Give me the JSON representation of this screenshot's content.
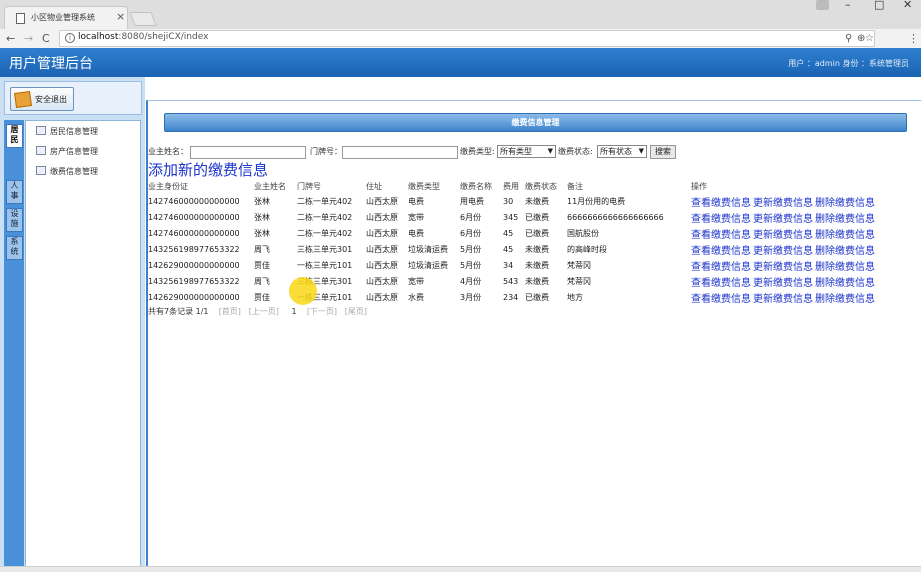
{
  "browser": {
    "tab_title": "小区物业管理系统",
    "tab_close": "×",
    "url_host": "localhost",
    "url_path": ":8080/shejiCX/index",
    "win_min": "–",
    "win_max": "□",
    "win_close": "✕",
    "back": "←",
    "forward": "→",
    "reload": "C",
    "menu": "⋮",
    "zoom_icon": "⊕",
    "pin_icon": "⚲",
    "star_icon": "☆"
  },
  "header": {
    "title": "用户管理后台",
    "user_info": "用户 ：admin  身份 ：系统管理员"
  },
  "sidebar": {
    "logout_label": "安全退出",
    "vtabs": [
      "居民",
      "人事",
      "设施",
      "系统"
    ],
    "items": [
      {
        "label": "居民信息管理"
      },
      {
        "label": "房产信息管理"
      },
      {
        "label": "缴费信息管理"
      }
    ]
  },
  "main": {
    "panel_title": "缴费信息管理",
    "search": {
      "owner_name_label": "业主姓名：",
      "door_label": "门牌号：",
      "type_label": "缴费类型:",
      "type_value": "所有类型",
      "status_label": "缴费状态:",
      "status_value": "所有状态",
      "button": "搜索"
    },
    "add_link": "添加新的缴费信息",
    "columns": [
      "业主身份证",
      "业主姓名",
      "门牌号",
      "住址",
      "缴费类型",
      "缴费名称",
      "费用",
      "缴费状态",
      "备注",
      "操作"
    ],
    "rows": [
      [
        "142746000000000000",
        "张林",
        "二栋一单元402",
        "山西太原",
        "电费",
        "用电费",
        "30",
        "未缴费",
        "11月份用的电费"
      ],
      [
        "142746000000000000",
        "张林",
        "二栋一单元402",
        "山西太原",
        "宽带",
        "6月份",
        "345",
        "已缴费",
        "6666666666666666666"
      ],
      [
        "142746000000000000",
        "张林",
        "二栋一单元402",
        "山西太原",
        "电费",
        "6月份",
        "45",
        "已缴费",
        "国航股份"
      ],
      [
        "143256198977653322",
        "周飞",
        "三栋三单元301",
        "山西太原",
        "垃圾清运费",
        "5月份",
        "45",
        "未缴费",
        "的高峰时段"
      ],
      [
        "142629000000000000",
        "贾佳",
        "一栋三单元101",
        "山西太原",
        "垃圾清运费",
        "5月份",
        "34",
        "未缴费",
        "梵蒂冈"
      ],
      [
        "143256198977653322",
        "周飞",
        "三栋三单元301",
        "山西太原",
        "宽带",
        "4月份",
        "543",
        "未缴费",
        "梵蒂冈"
      ],
      [
        "142629000000000000",
        "贾佳",
        "一栋三单元101",
        "山西太原",
        "水费",
        "3月份",
        "234",
        "已缴费",
        "地方"
      ]
    ],
    "ops": [
      "查看缴费信息",
      "更新缴费信息",
      "删除缴费信息"
    ],
    "pager": {
      "summary": "共有7条记录  1/1",
      "first": "[首页]",
      "prev": "[上一页]",
      "current": "1",
      "next": "[下一页]",
      "last": "[尾页]"
    }
  }
}
